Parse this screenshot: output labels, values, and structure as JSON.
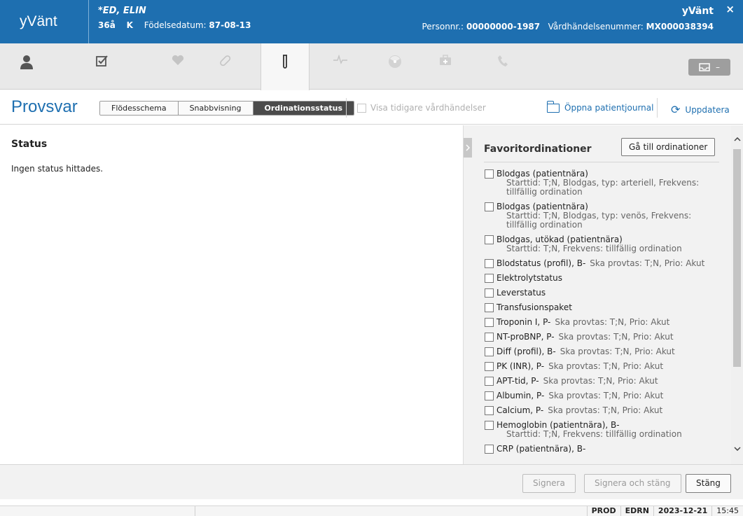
{
  "header": {
    "app_name": "yVänt",
    "patient_name": "*ED, ELIN",
    "age": "36å",
    "sex": "K",
    "birth_label": "Födelsedatum:",
    "birth_date": "87-08-13",
    "right_app": "yVänt",
    "close_glyph": "×",
    "pnr_label": "Personnr.:",
    "pnr_value": "00000000-1987",
    "encounter_label": "Vårdhändelsenummer:",
    "encounter_value": "MX000038394"
  },
  "toolbar": {
    "icons": [
      "person-icon",
      "checklist-icon",
      "heart-icon",
      "bandage-icon",
      "test-tube-icon",
      "ecg-icon",
      "radiation-icon",
      "medical-kit-icon",
      "phone-icon"
    ],
    "tray_glyph": "–"
  },
  "titlebar": {
    "title": "Provsvar",
    "segments": [
      "Flödesschema",
      "Snabbvisning",
      "Ordinationsstatus"
    ],
    "active_segment": "Ordinationsstatus",
    "show_previous": "Visa tidigare vårdhändelser",
    "open_journal": "Öppna patientjournal",
    "refresh": "Uppdatera"
  },
  "status": {
    "heading": "Status",
    "message": "Ingen status hittades."
  },
  "favorites": {
    "title": "Favoritordinationer",
    "goto_button": "Gå till ordinationer",
    "items": [
      {
        "name": "Blodgas (patientnära)",
        "suffix": "",
        "detail": "Starttid: T;N, Blodgas, typ: arteriell, Frekvens: tillfällig ordination"
      },
      {
        "name": "Blodgas (patientnära)",
        "suffix": "",
        "detail": "Starttid: T;N, Blodgas, typ: venös, Frekvens: tillfällig ordination"
      },
      {
        "name": "Blodgas, utökad (patientnära)",
        "suffix": "",
        "detail": "Starttid: T;N, Frekvens: tillfällig ordination"
      },
      {
        "name": "Blodstatus (profil), B-",
        "suffix": "Ska provtas: T;N, Prio: Akut",
        "detail": ""
      },
      {
        "name": "Elektrolytstatus",
        "suffix": "",
        "detail": ""
      },
      {
        "name": "Leverstatus",
        "suffix": "",
        "detail": ""
      },
      {
        "name": "Transfusionspaket",
        "suffix": "",
        "detail": ""
      },
      {
        "name": "Troponin I, P-",
        "suffix": "Ska provtas: T;N, Prio: Akut",
        "detail": ""
      },
      {
        "name": "NT-proBNP, P-",
        "suffix": "Ska provtas: T;N, Prio: Akut",
        "detail": ""
      },
      {
        "name": "Diff (profil), B-",
        "suffix": "Ska provtas: T;N, Prio: Akut",
        "detail": ""
      },
      {
        "name": "PK (INR), P-",
        "suffix": "Ska provtas: T;N, Prio: Akut",
        "detail": ""
      },
      {
        "name": "APT-tid, P-",
        "suffix": "Ska provtas: T;N, Prio: Akut",
        "detail": ""
      },
      {
        "name": "Albumin, P-",
        "suffix": "Ska provtas: T;N, Prio: Akut",
        "detail": ""
      },
      {
        "name": "Calcium, P-",
        "suffix": "Ska provtas: T;N, Prio: Akut",
        "detail": ""
      },
      {
        "name": "Hemoglobin (patientnära), B-",
        "suffix": "",
        "detail": "Starttid: T;N, Frekvens: tillfällig ordination"
      },
      {
        "name": "CRP (patientnära), B-",
        "suffix": "",
        "detail": ""
      }
    ]
  },
  "footer": {
    "sign": "Signera",
    "sign_close": "Signera och stäng",
    "close": "Stäng"
  },
  "statusbar": {
    "env": "PROD",
    "unit": "EDRN",
    "date": "2023-12-21",
    "time": "15:45"
  },
  "colors": {
    "header_blue": "#1e6fb0",
    "active_segment": "#4b4b4b"
  }
}
